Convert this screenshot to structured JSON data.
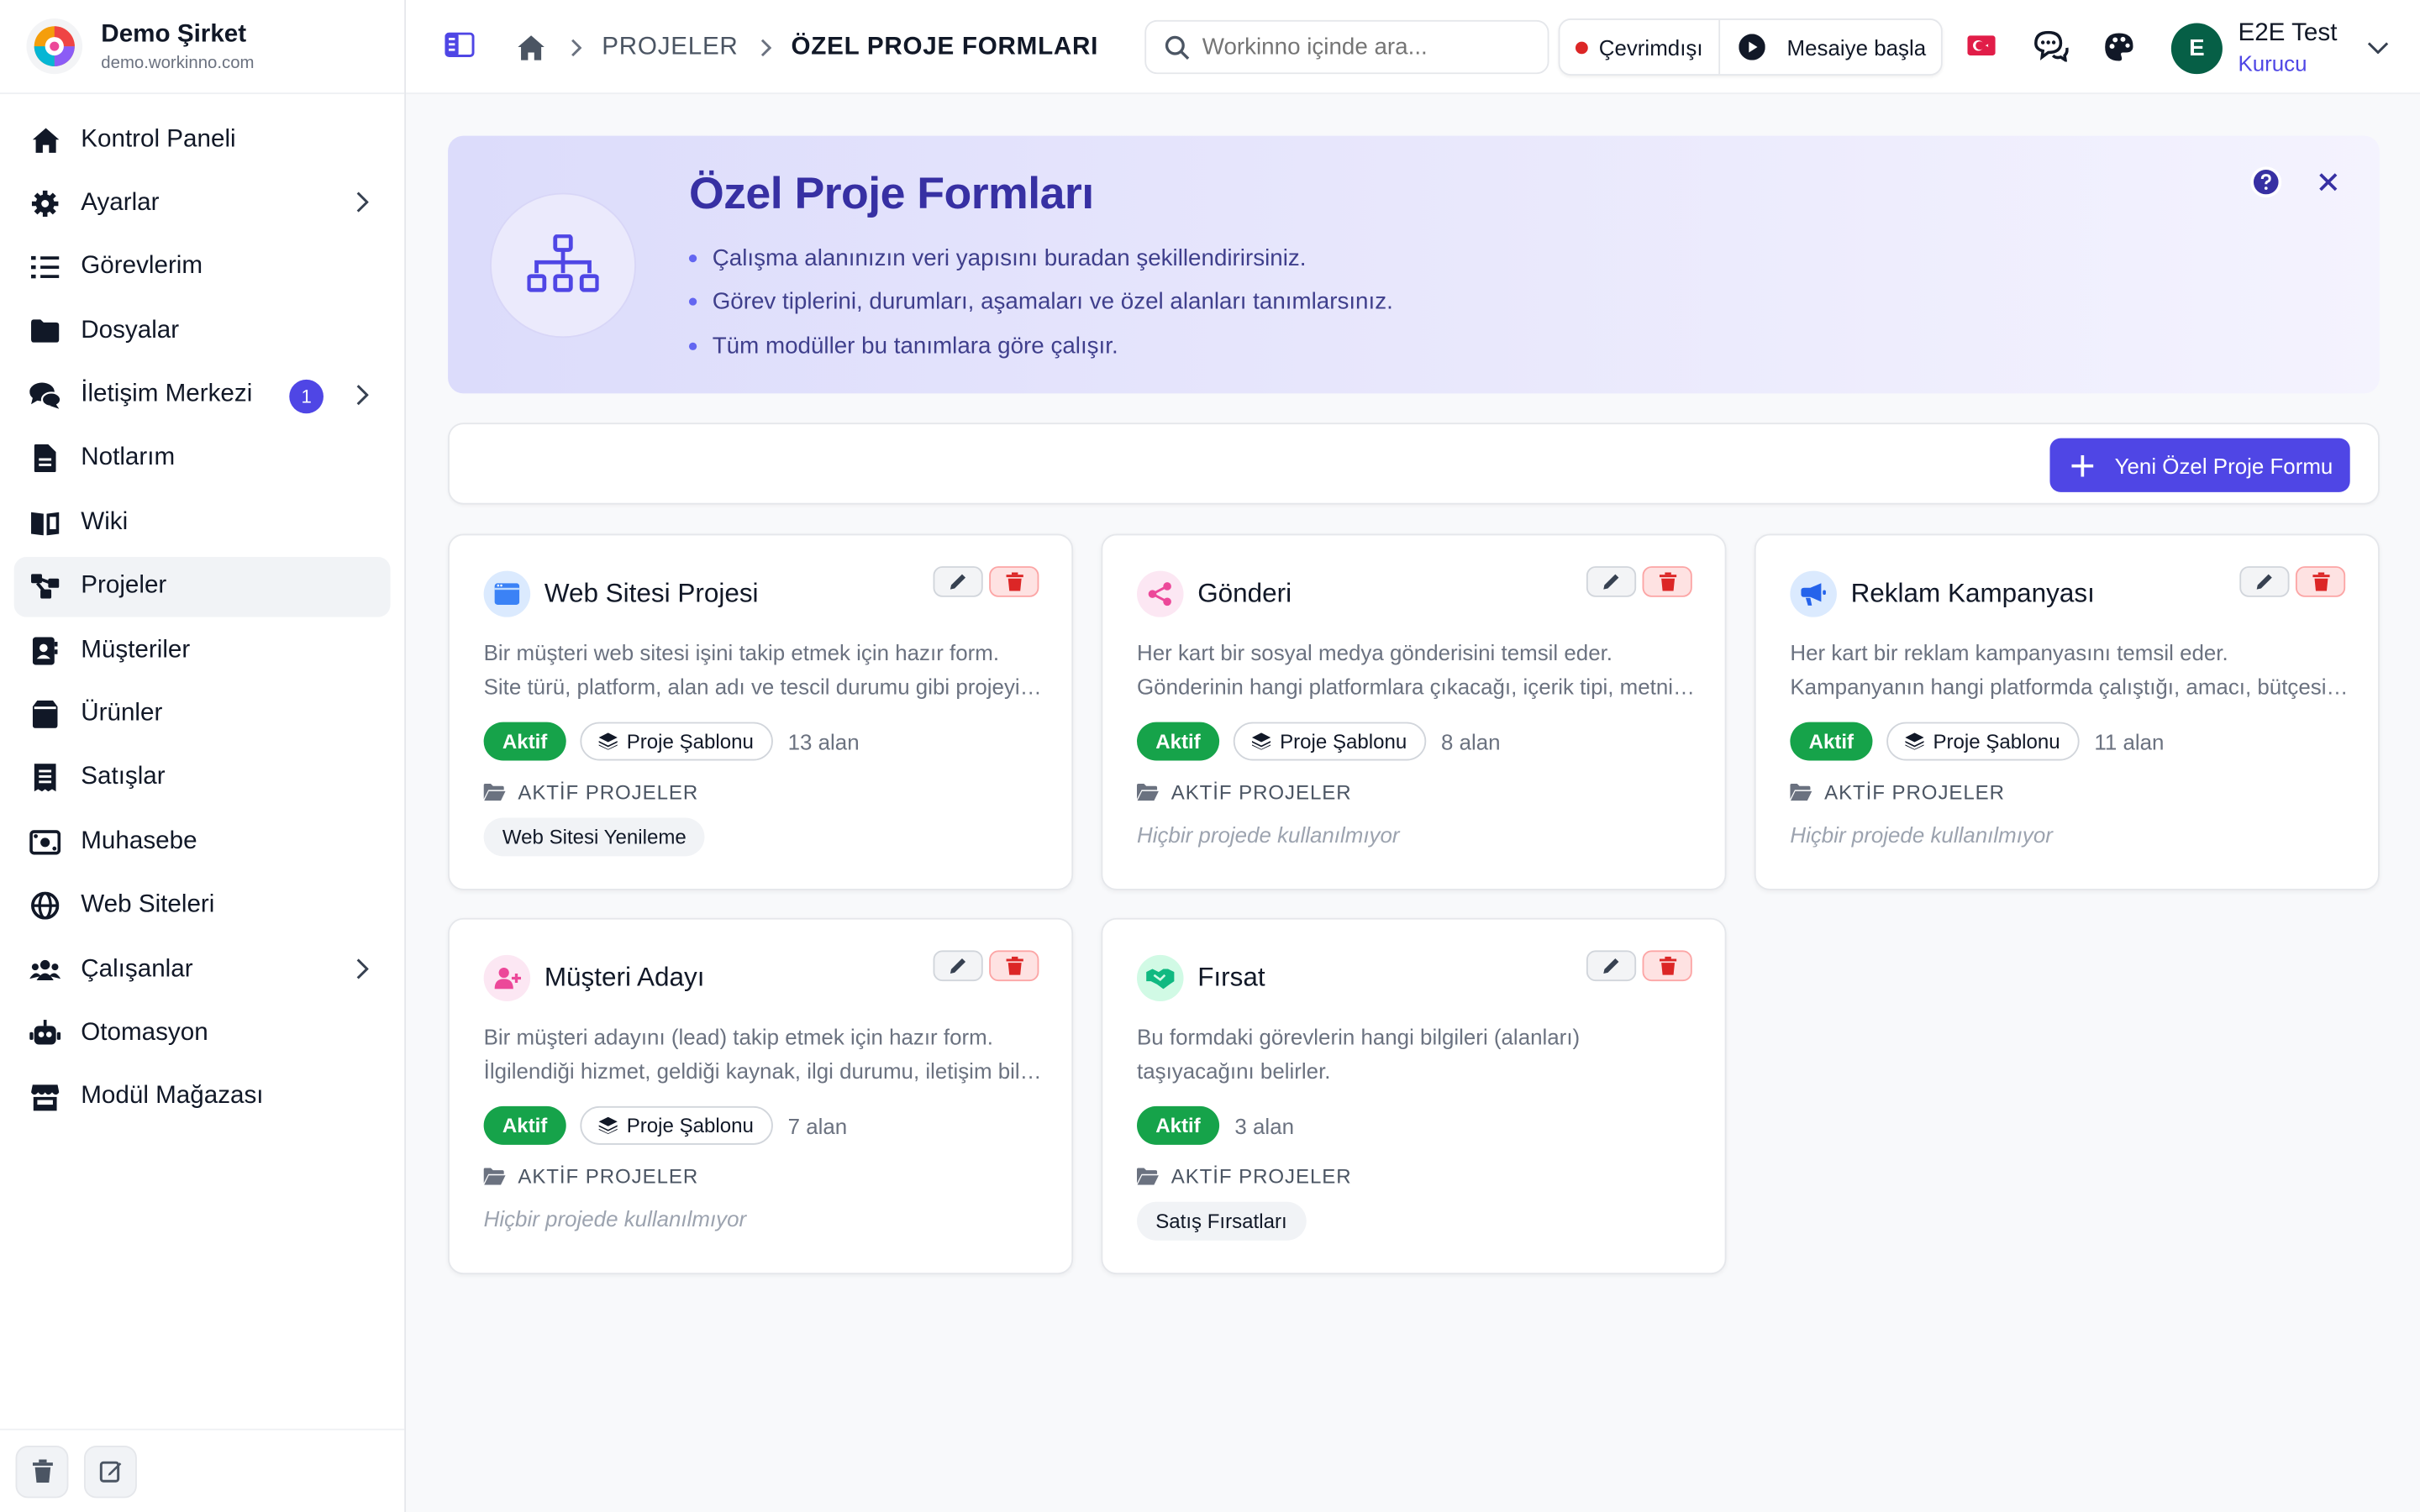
{
  "brand": {
    "name": "Demo Şirket",
    "domain": "demo.workinno.com"
  },
  "sidebar": {
    "items": [
      {
        "label": "Kontrol Paneli",
        "icon": "home-icon"
      },
      {
        "label": "Ayarlar",
        "icon": "gear-icon",
        "chevron": true
      },
      {
        "label": "Görevlerim",
        "icon": "tasks-icon"
      },
      {
        "label": "Dosyalar",
        "icon": "folder-icon"
      },
      {
        "label": "İletişim Merkezi",
        "icon": "chat-icon",
        "chevron": true,
        "badge": "1"
      },
      {
        "label": "Notlarım",
        "icon": "note-icon"
      },
      {
        "label": "Wiki",
        "icon": "book-icon"
      },
      {
        "label": "Projeler",
        "icon": "project-icon",
        "active": true
      },
      {
        "label": "Müşteriler",
        "icon": "contacts-icon"
      },
      {
        "label": "Ürünler",
        "icon": "product-icon"
      },
      {
        "label": "Satışlar",
        "icon": "receipt-icon"
      },
      {
        "label": "Muhasebe",
        "icon": "money-icon"
      },
      {
        "label": "Web Siteleri",
        "icon": "globe-icon"
      },
      {
        "label": "Çalışanlar",
        "icon": "users-icon",
        "chevron": true
      },
      {
        "label": "Otomasyon",
        "icon": "robot-icon"
      },
      {
        "label": "Modül Mağazası",
        "icon": "store-icon"
      }
    ]
  },
  "breadcrumb": {
    "level1": "PROJELER",
    "current": "ÖZEL PROJE FORMLARI"
  },
  "search": {
    "placeholder": "Workinno içinde ara..."
  },
  "status": {
    "offline_label": "Çevrimdışı",
    "start_label": "Mesaiye başla"
  },
  "user": {
    "initial": "E",
    "name": "E2E Test",
    "role": "Kurucu"
  },
  "hero": {
    "title": "Özel Proje Formları",
    "bullets": [
      "Çalışma alanınızın veri yapısını buradan şekillendirirsiniz.",
      "Görev tiplerini, durumları, aşamaları ve özel alanları tanımlarsınız.",
      "Tüm modüller bu tanımlara göre çalışır."
    ]
  },
  "actions": {
    "new_form_label": "Yeni Özel Proje Formu"
  },
  "labels": {
    "active": "Aktif",
    "template": "Proje Şablonu",
    "active_projects": "AKTİF PROJELER",
    "not_used": "Hiçbir projede kullanılmıyor"
  },
  "colors": {
    "accent": "#4f46e5",
    "success": "#16a34a",
    "danger": "#dc2626"
  },
  "cards": [
    {
      "title": "Web Sitesi Projesi",
      "icon": "browser-window-icon",
      "icon_color": "#3b82f6",
      "icon_bg": "#dbeafe",
      "desc1": "Bir müşteri web sitesi işini takip etmek için hazır form.",
      "desc2": "Site türü, platform, alan adı ve tescil durumu gibi projeyi takip etmek için gerekli alanları içerir.",
      "fields": "13 alan",
      "project": "Web Sitesi Yenileme"
    },
    {
      "title": "Gönderi",
      "icon": "share-icon",
      "icon_color": "#ec4899",
      "icon_bg": "#fce7f3",
      "desc1": "Her kart bir sosyal medya gönderisini temsil eder.",
      "desc2": "Gönderinin hangi platformlara çıkacağı, içerik tipi, metni ve yayın tarihi gibi bilgileri içerir.",
      "fields": "8 alan",
      "project": ""
    },
    {
      "title": "Reklam Kampanyası",
      "icon": "megaphone-icon",
      "icon_color": "#2563eb",
      "icon_bg": "#dbeafe",
      "desc1": "Her kart bir reklam kampanyasını temsil eder.",
      "desc2": "Kampanyanın hangi platformda çalıştığı, amacı, bütçesi, tarihleri ve sonuçlarını içerir.",
      "fields": "11 alan",
      "project": ""
    },
    {
      "title": "Müşteri Adayı",
      "icon": "user-plus-icon",
      "icon_color": "#ec4899",
      "icon_bg": "#fce7f3",
      "desc1": "Bir müşteri adayını (lead) takip etmek için hazır form.",
      "desc2": "İlgilendiği hizmet, geldiği kaynak, ilgi durumu, iletişim bilgileri ve notları içerir.",
      "fields": "7 alan",
      "project": ""
    },
    {
      "title": "Fırsat",
      "icon": "handshake-icon",
      "icon_color": "#10b981",
      "icon_bg": "#d1fae5",
      "desc1": "Bu formdaki görevlerin hangi bilgileri (alanları)",
      "desc2": "taşıyacağını belirler.",
      "fields": "3 alan",
      "project": "Satış Fırsatları"
    }
  ]
}
